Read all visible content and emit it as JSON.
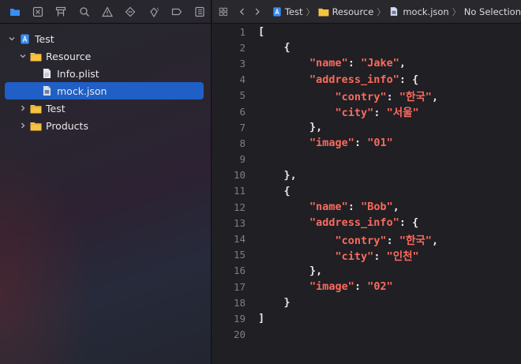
{
  "sidebar": {
    "toolbar_icons": [
      "folder-icon",
      "x-square-icon",
      "hierarchy-icon",
      "search-icon",
      "warning-icon",
      "diamond-icon",
      "spray-icon",
      "tag-icon",
      "list-icon"
    ],
    "tree": [
      {
        "label": "Test",
        "icon": "project-icon",
        "depth": 0,
        "expanded": true
      },
      {
        "label": "Resource",
        "icon": "folder-icon",
        "depth": 1,
        "expanded": true
      },
      {
        "label": "Info.plist",
        "icon": "file-icon",
        "depth": 2
      },
      {
        "label": "mock.json",
        "icon": "json-file-icon",
        "depth": 2,
        "selected": true
      },
      {
        "label": "Test",
        "icon": "folder-icon",
        "depth": 1,
        "expanded": false
      },
      {
        "label": "Products",
        "icon": "folder-icon",
        "depth": 1,
        "expanded": false
      }
    ]
  },
  "editor": {
    "breadcrumb": [
      "Test",
      "Resource",
      "mock.json",
      "No Selection"
    ],
    "lines": [
      "[",
      "    {",
      "        \"name\": \"Jake\",",
      "        \"address_info\": {",
      "            \"contry\": \"한국\",",
      "            \"city\": \"서울\"",
      "        },",
      "        \"image\": \"01\"",
      "",
      "    },",
      "    {",
      "        \"name\": \"Bob\",",
      "        \"address_info\": {",
      "            \"contry\": \"한국\",",
      "            \"city\": \"인천\"",
      "        },",
      "        \"image\": \"02\"",
      "    }",
      "]",
      ""
    ]
  },
  "colors": {
    "accent": "#1f5fc6",
    "string": "#fc6a5d",
    "folder": "#f5c342",
    "line_number": "#7e7e84"
  }
}
